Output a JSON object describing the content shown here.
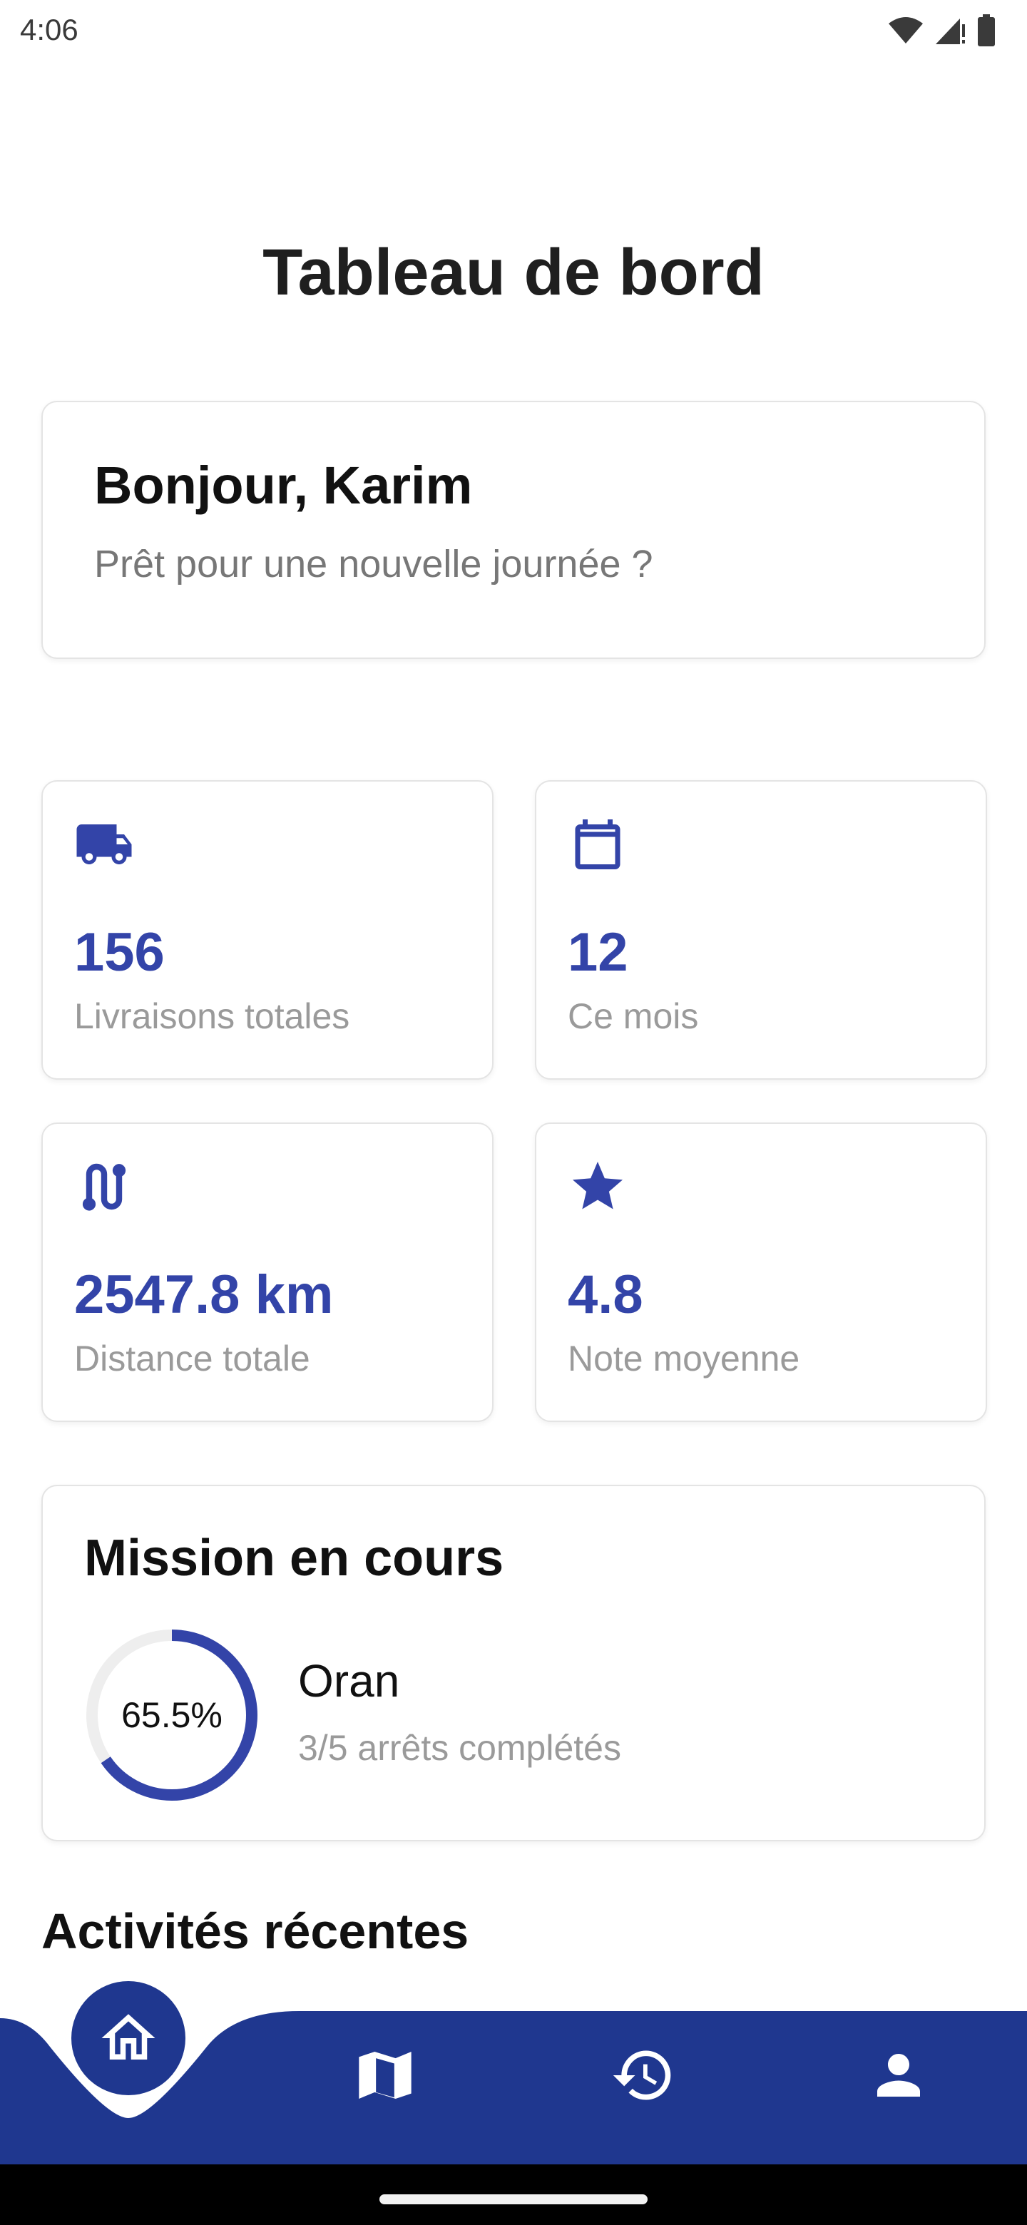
{
  "status_bar": {
    "time": "4:06",
    "icons": [
      "wifi-icon",
      "cell-signal-icon",
      "battery-icon"
    ]
  },
  "page": {
    "title": "Tableau de bord"
  },
  "greeting": {
    "title": "Bonjour, Karim",
    "subtitle": "Prêt pour une nouvelle journée ?"
  },
  "stats": [
    {
      "icon": "truck-icon",
      "value": "156",
      "label": "Livraisons totales"
    },
    {
      "icon": "calendar-icon",
      "value": "12",
      "label": "Ce mois"
    },
    {
      "icon": "route-icon",
      "value": "2547.8 km",
      "label": "Distance totale"
    },
    {
      "icon": "star-icon",
      "value": "4.8",
      "label": "Note moyenne"
    }
  ],
  "mission": {
    "title": "Mission en cours",
    "progress_label": "65.5%",
    "progress_fraction": 0.655,
    "city": "Oran",
    "stops": "3/5 arrêts complétés"
  },
  "recent": {
    "title": "Activités récentes"
  },
  "nav": {
    "items": [
      "home-icon",
      "map-icon",
      "history-icon",
      "profile-icon"
    ],
    "active": "home-icon"
  },
  "colors": {
    "accent": "#3344a8",
    "nav_background": "#1f378f",
    "ring_track": "#eeeeee"
  }
}
